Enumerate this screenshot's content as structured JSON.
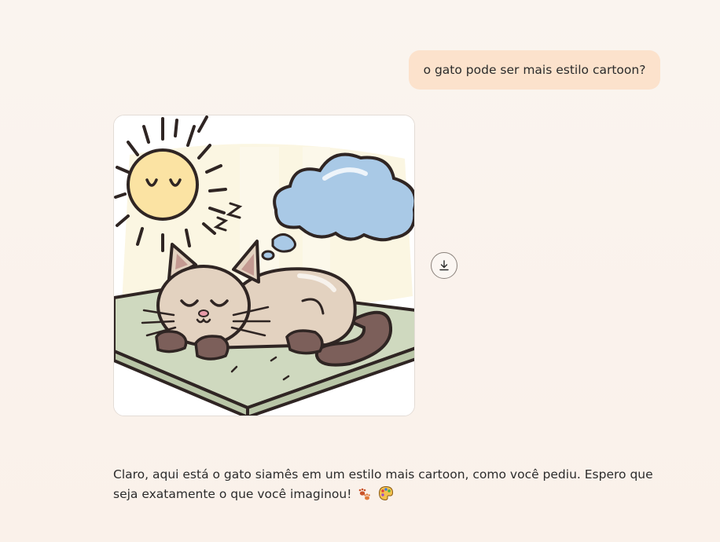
{
  "conversation": {
    "user_message": "o gato pode ser mais estilo cartoon?",
    "assistant_message": "Claro, aqui está o gato siamês em um estilo mais cartoon, como você pediu. Espero que seja exatamente o que você imaginou!",
    "emojis": [
      "paw-prints-icon",
      "artist-palette-icon"
    ]
  },
  "image_card": {
    "subject_icon": "sleeping-cartoon-cat-illustration"
  },
  "download": {
    "icon": "download-icon"
  },
  "colors": {
    "user_bubble": "#fce2cc",
    "background": "#faf4ef",
    "text": "#2b2b2b",
    "cat_body": "#e3d2c0",
    "cat_tail": "#7c5f5a",
    "cushion": "#cfd9bf",
    "sun": "#fbe3a3",
    "cloud": "#a9c9e6",
    "outline": "#2f2523"
  }
}
